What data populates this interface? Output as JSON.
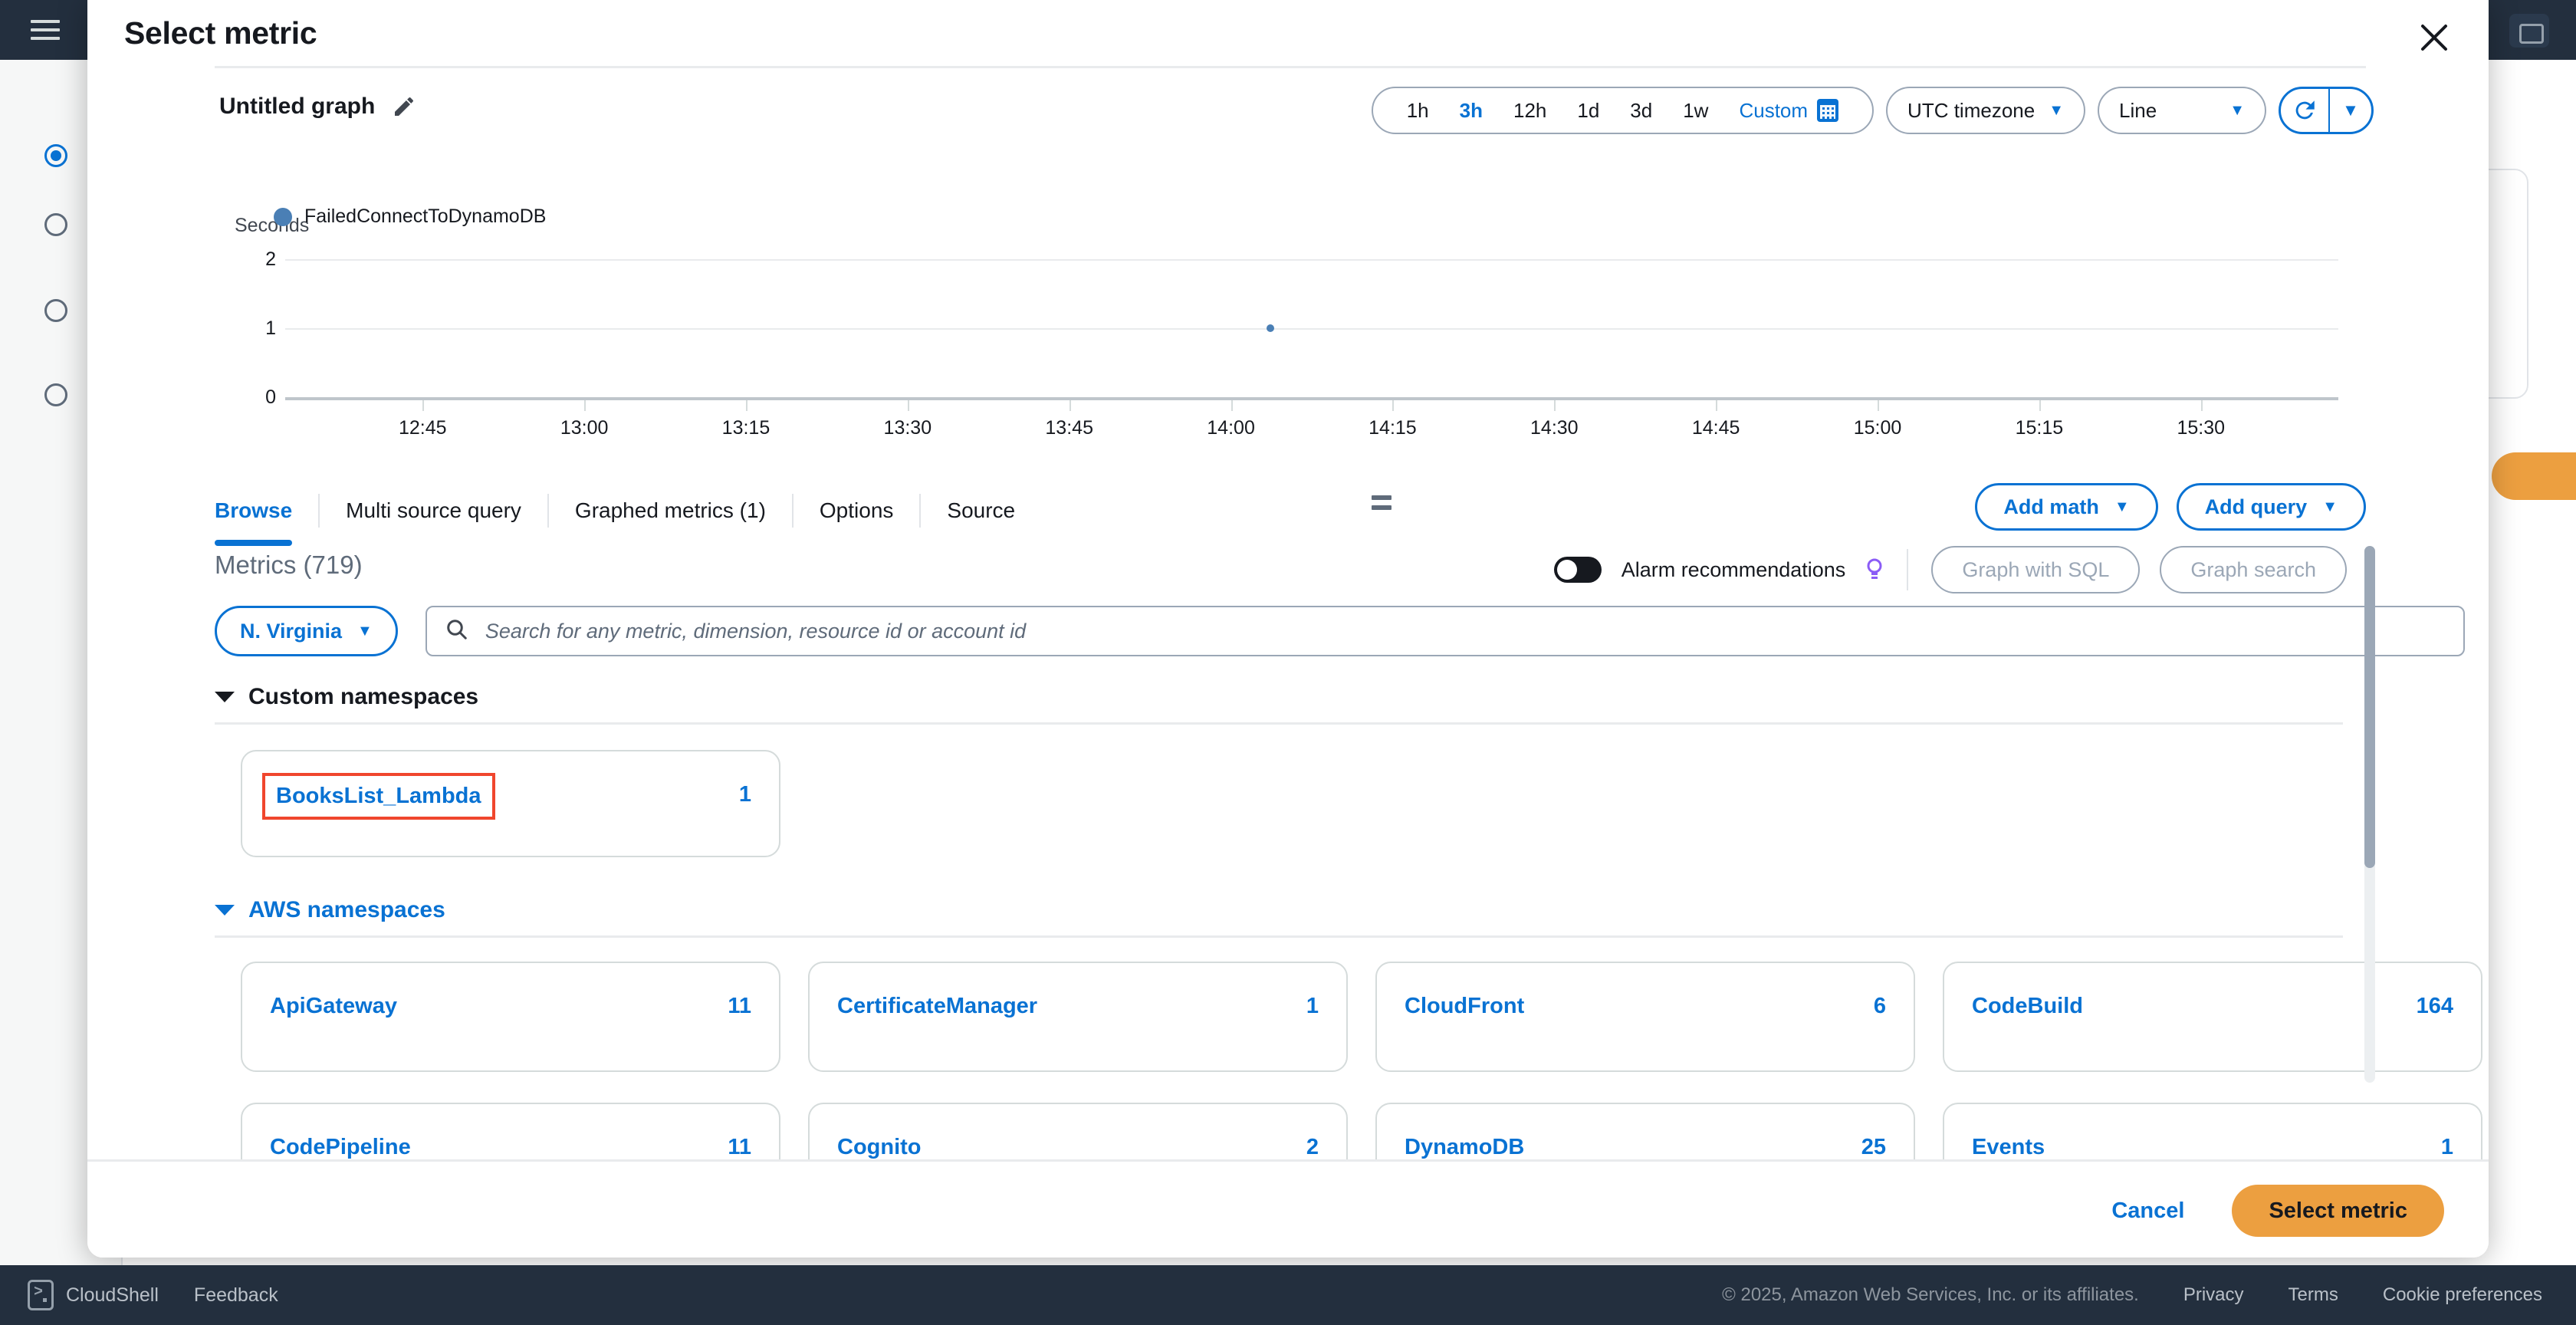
{
  "background": {
    "hamburger_icon": "hamburger-menu-icon",
    "right_icon": "panel-icon"
  },
  "modal": {
    "title": "Select metric",
    "close_icon": "close-icon",
    "graph_title": "Untitled graph",
    "edit_icon": "pencil-icon"
  },
  "toolbar": {
    "ranges": [
      {
        "label": "1h",
        "active": false
      },
      {
        "label": "3h",
        "active": true
      },
      {
        "label": "12h",
        "active": false
      },
      {
        "label": "1d",
        "active": false
      },
      {
        "label": "3d",
        "active": false
      },
      {
        "label": "1w",
        "active": false
      }
    ],
    "custom_label": "Custom",
    "calendar_icon": "calendar-icon",
    "timezone_label": "UTC timezone",
    "chart_type_label": "Line",
    "refresh_icon": "refresh-icon",
    "refresh_caret_icon": "chevron-down-icon"
  },
  "chart_data": {
    "type": "line",
    "title": "Untitled graph",
    "ylabel": "Seconds",
    "xlabel": "",
    "yticks": [
      "0",
      "1",
      "2"
    ],
    "ylim": [
      0,
      2
    ],
    "grid": true,
    "legend_position": "bottom-left",
    "categories": [
      "12:45",
      "13:00",
      "13:15",
      "13:30",
      "13:45",
      "14:00",
      "14:15",
      "14:30",
      "14:45",
      "15:00",
      "15:15",
      "15:30"
    ],
    "series": [
      {
        "name": "FailedConnectToDynamoDB",
        "color": "#4a7fb5",
        "points": [
          {
            "x": "13:53",
            "y": 1
          }
        ],
        "values": [
          null,
          null,
          null,
          null,
          null,
          null,
          null,
          null,
          null,
          null,
          null,
          null
        ]
      }
    ]
  },
  "tabs": [
    {
      "label": "Browse",
      "active": true
    },
    {
      "label": "Multi source query",
      "active": false
    },
    {
      "label": "Graphed metrics (1)",
      "active": false
    },
    {
      "label": "Options",
      "active": false
    },
    {
      "label": "Source",
      "active": false
    }
  ],
  "tab_actions": {
    "add_math_label": "Add math",
    "add_query_label": "Add query",
    "drag_handle_icon": "drag-handle-icon"
  },
  "metrics": {
    "heading": "Metrics",
    "count": "(719)",
    "alarm_toggle_label": "Alarm recommendations",
    "bulb_icon": "lightbulb-icon",
    "graph_with_sql_label": "Graph with SQL",
    "graph_search_label": "Graph search",
    "region_label": "N. Virginia",
    "search_placeholder": "Search for any metric, dimension, resource id or account id",
    "search_value": "",
    "search_icon": "search-icon"
  },
  "custom_namespaces": {
    "title": "Custom namespaces",
    "expanded": true,
    "items": [
      {
        "name": "BooksList_Lambda",
        "count": "1",
        "highlighted": true
      }
    ]
  },
  "aws_namespaces": {
    "title": "AWS namespaces",
    "expanded": true,
    "items": [
      {
        "name": "ApiGateway",
        "count": "11"
      },
      {
        "name": "CertificateManager",
        "count": "1"
      },
      {
        "name": "CloudFront",
        "count": "6"
      },
      {
        "name": "CodeBuild",
        "count": "164"
      },
      {
        "name": "CodePipeline",
        "count": "11"
      },
      {
        "name": "Cognito",
        "count": "2"
      },
      {
        "name": "DynamoDB",
        "count": "25"
      },
      {
        "name": "Events",
        "count": "1"
      }
    ]
  },
  "footer": {
    "cancel_label": "Cancel",
    "select_metric_label": "Select metric"
  },
  "console_bar": {
    "cloudshell_label": "CloudShell",
    "cloudshell_icon": "cloudshell-icon",
    "feedback_label": "Feedback",
    "copyright": "© 2025, Amazon Web Services, Inc. or its affiliates.",
    "links": [
      "Privacy",
      "Terms",
      "Cookie preferences"
    ]
  },
  "colors": {
    "accent_blue": "#0972d3",
    "orange": "#ec9f40",
    "highlight_red": "#f0462d",
    "series_blue": "#4a7fb5",
    "dark_navy": "#232f3e"
  }
}
